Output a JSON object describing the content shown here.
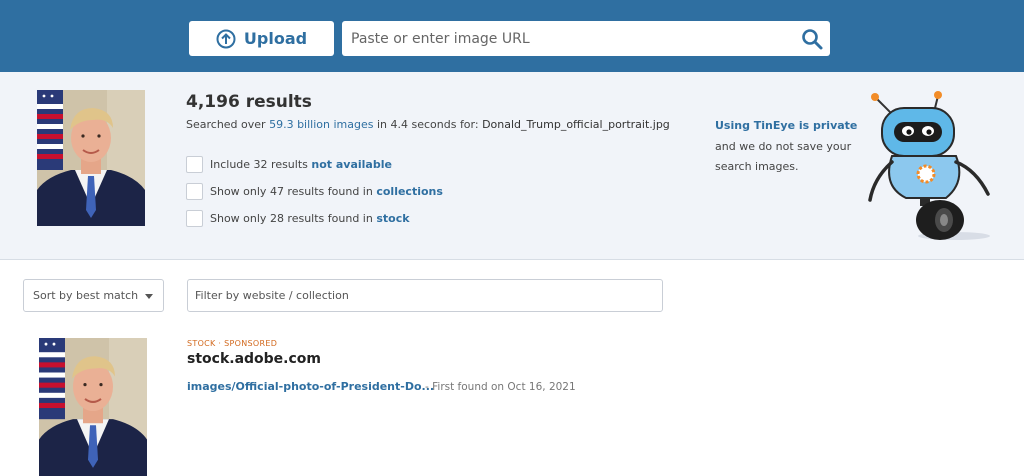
{
  "header": {
    "upload_label": "Upload",
    "url_placeholder": "Paste or enter image URL",
    "brand_color": "#2f6fa1"
  },
  "summary": {
    "results_count": "4,196 results",
    "searched_prefix": "Searched over ",
    "searched_count": "59.3 billion images",
    "searched_middle": " in 4.4 seconds for: ",
    "filename": "Donald_Trump_official_portrait.jpg",
    "options": [
      {
        "text": "Include 32 results ",
        "link": "not available"
      },
      {
        "text": "Show only 47 results found in ",
        "link": "collections"
      },
      {
        "text": "Show only 28 results found in ",
        "link": "stock"
      }
    ],
    "privacy_link": "Using TinEye is private",
    "privacy_text": "and we do not save your search images."
  },
  "filters": {
    "sort_value": "Sort by best match",
    "filter_placeholder": "Filter by website / collection"
  },
  "result": {
    "tags": "STOCK · SPONSORED",
    "domain": "stock.adobe.com",
    "link": "images/Official-photo-of-President-Do...",
    "found": "- First found on Oct 16, 2021"
  },
  "icons": {
    "upload": "upload-arrow-icon",
    "search": "search-icon",
    "caret": "chevron-down-icon",
    "robot": "tineye-robot-mascot"
  }
}
